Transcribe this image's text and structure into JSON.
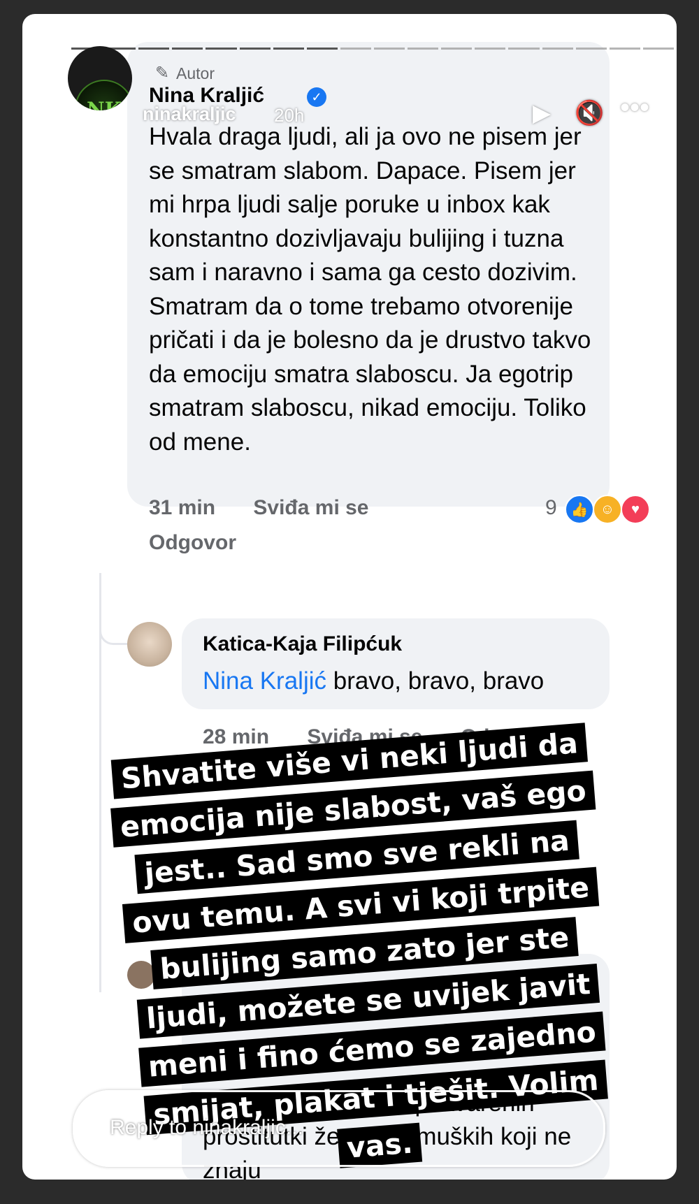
{
  "story": {
    "username": "ninakraljic",
    "time": "20h",
    "reply_placeholder": "Reply to ninakraljic...",
    "avatar_text": "NK",
    "icons": {
      "play": "play-icon",
      "mute": "mute-icon",
      "more": "more-icon",
      "send": "send-icon"
    }
  },
  "comment": {
    "badge": "Autor",
    "author": "Nina Kraljić",
    "text": "Hvala draga ljudi, ali ja ovo ne pisem jer se smatram slabom. Dapace. Pisem jer mi hrpa ljudi salje poruke u inbox kak konstantno dozivljavaju bulijing i tuzna sam i naravno i sama ga cesto dozivim. Smatram da o tome trebamo otvorenije pričati i da je bolesno da je drustvo takvo da emociju smatra slaboscu. Ja egotrip smatram slaboscu, nikad emociju. Toliko od mene.",
    "time": "31 min",
    "like": "Sviđa mi se",
    "reply": "Odgovor",
    "reaction_count": "9"
  },
  "reply": {
    "author": "Katica-Kaja Filipćuk",
    "mention": "Nina Kraljić",
    "text": " bravo, bravo, bravo",
    "time": "28 min",
    "like": "Sviđa mi se",
    "reply": "Odgovor"
  },
  "partial_comment": {
    "text": "...lajivi show je pun pokvarenih prostitutki ženskih i muških koji ne znaju"
  },
  "caption": {
    "lines": [
      "Shvatite više vi neki ljudi da",
      "emocija nije slabost, vaš ego",
      "jest.. Sad smo sve rekli na",
      "ovu temu. A svi vi koji trpite",
      "bulijing samo zato jer ste",
      "ljudi, možete se uvijek javit",
      "meni i fino ćemo se zajedno",
      "smijat, plakat i tješit. Volim",
      "vas."
    ]
  }
}
